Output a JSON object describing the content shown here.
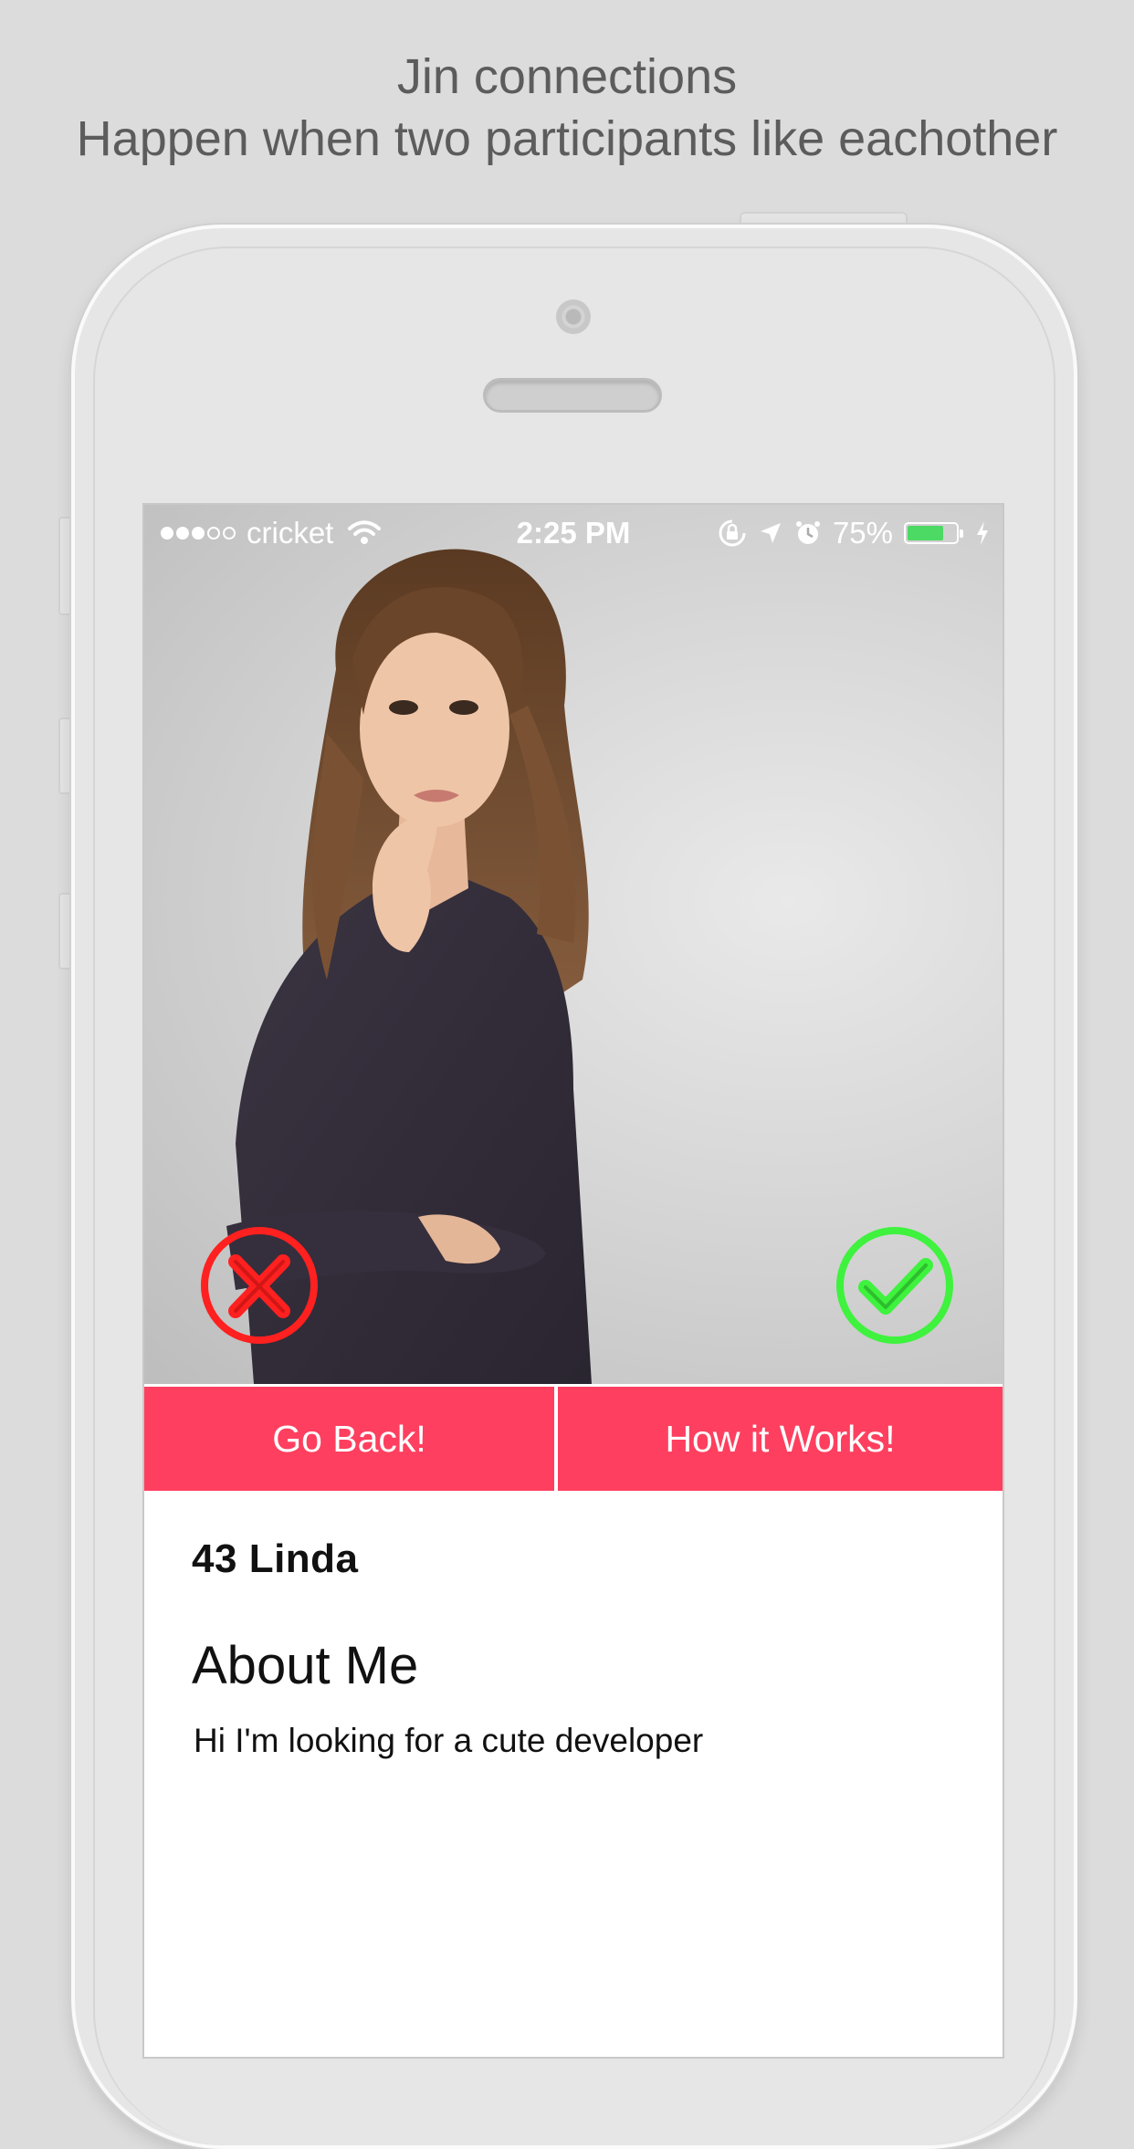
{
  "headline": {
    "line1": "Jin connections",
    "line2": "Happen when two participants like eachother"
  },
  "status_bar": {
    "carrier": "cricket",
    "signal_bars_filled": 3,
    "signal_bars_total": 5,
    "time": "2:25 PM",
    "battery_percent": "75%",
    "battery_level": 0.75,
    "icons": [
      "wifi-icon",
      "rotation-lock-icon",
      "location-icon",
      "alarm-icon",
      "battery-icon",
      "charging-bolt-icon"
    ]
  },
  "card": {
    "photo_description_icon": "profile-photo",
    "reject_icon": "x-circle-icon",
    "accept_icon": "check-circle-icon",
    "reject_color": "#ff2020",
    "accept_color": "#3ef23e"
  },
  "actions": {
    "go_back_label": "Go Back!",
    "how_it_works_label": "How it Works!",
    "accent_color": "#ff3f5f"
  },
  "profile": {
    "age": "43",
    "name": "Linda",
    "about_title": "About Me",
    "about_text": "Hi I'm looking for a cute developer"
  }
}
